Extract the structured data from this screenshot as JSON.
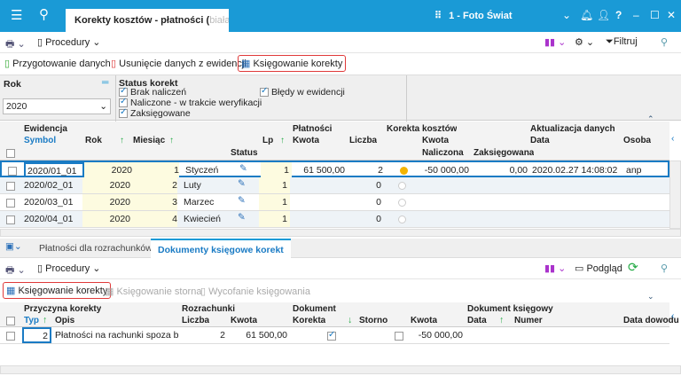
{
  "window": {
    "tab_title": "Korekty kosztów - płatności (",
    "tab_title_fade": "biała",
    "company": "1 - Foto Świat"
  },
  "toolbar": {
    "procedury": "Procedury",
    "filtruj": "Filtruj"
  },
  "actions": {
    "przygotowanie": "Przygotowanie danych",
    "usuniecie": "Usunięcie danych z ewidencji",
    "ksiegowanie": "Księgowanie korekty"
  },
  "filter": {
    "rok_label": "Rok",
    "rok_value": "2020",
    "status_label": "Status korekt",
    "statuses": [
      {
        "label": "Brak naliczeń",
        "checked": true
      },
      {
        "label": "Naliczone - w trakcie weryfikacji",
        "checked": true
      },
      {
        "label": "Zaksięgowane",
        "checked": true
      },
      {
        "label": "Błędy w ewidencji",
        "checked": true
      }
    ]
  },
  "grid": {
    "groups": {
      "ewidencja": "Ewidencja",
      "platnosci": "Płatności",
      "korekta": "Korekta kosztów",
      "aktualizacja": "Aktualizacja danych"
    },
    "columns": {
      "symbol": "Symbol",
      "rok": "Rok",
      "miesiac": "Miesiąc",
      "status": "Status",
      "lp": "Lp",
      "kwota": "Kwota",
      "liczba": "Liczba",
      "kwota2": "Kwota",
      "naliczona": "Naliczona",
      "zaksiegowana": "Zaksięgowana",
      "data": "Data",
      "osoba": "Osoba"
    },
    "rows": [
      {
        "symbol": "2020/01_01",
        "rok": "2020",
        "miesiac": "1",
        "nazwa": "Styczeń",
        "lp": "1",
        "kwota": "61 500,00",
        "liczba": "2",
        "status_color": "#f5b400",
        "naliczona": "-50 000,00",
        "zaksiegowana": "0,00",
        "data": "2020.02.27 14:08:02",
        "osoba": "anp"
      },
      {
        "symbol": "2020/02_01",
        "rok": "2020",
        "miesiac": "2",
        "nazwa": "Luty",
        "lp": "1",
        "kwota": "",
        "liczba": "0",
        "status_color": "empty",
        "naliczona": "",
        "zaksiegowana": "",
        "data": "",
        "osoba": ""
      },
      {
        "symbol": "2020/03_01",
        "rok": "2020",
        "miesiac": "3",
        "nazwa": "Marzec",
        "lp": "1",
        "kwota": "",
        "liczba": "0",
        "status_color": "empty",
        "naliczona": "",
        "zaksiegowana": "",
        "data": "",
        "osoba": ""
      },
      {
        "symbol": "2020/04_01",
        "rok": "2020",
        "miesiac": "4",
        "nazwa": "Kwiecień",
        "lp": "1",
        "kwota": "",
        "liczba": "0",
        "status_color": "empty",
        "naliczona": "",
        "zaksiegowana": "",
        "data": "",
        "osoba": ""
      }
    ]
  },
  "bottom": {
    "tabs": [
      "Płatności dla rozrachunków",
      "Dokumenty księgowe korekt"
    ],
    "active_tab": 1,
    "toolbar": {
      "procedury": "Procedury",
      "podglad": "Podgląd"
    },
    "actions": {
      "ksiegowanie": "Księgowanie korekty",
      "storna": "Księgowanie storna",
      "wycofanie": "Wycofanie księgowania"
    },
    "groups": {
      "przyczyna": "Przyczyna korekty",
      "rozrachunki": "Rozrachunki",
      "dokument": "Dokument",
      "dokument_ksiegowy": "Dokument księgowy"
    },
    "columns": {
      "typ": "Typ",
      "opis": "Opis",
      "liczba": "Liczba",
      "kwota": "Kwota",
      "korekta": "Korekta",
      "storno": "Storno",
      "kwota2": "Kwota",
      "data": "Data",
      "numer": "Numer",
      "data_dowodu": "Data dowodu"
    },
    "rows": [
      {
        "typ": "2",
        "opis": "Płatności na rachunki spoza biał",
        "liczba": "2",
        "kwota": "61 500,00",
        "korekta": true,
        "storno": false,
        "kwota2": "-50 000,00",
        "data": "",
        "numer": "",
        "data_dowodu": ""
      }
    ]
  }
}
